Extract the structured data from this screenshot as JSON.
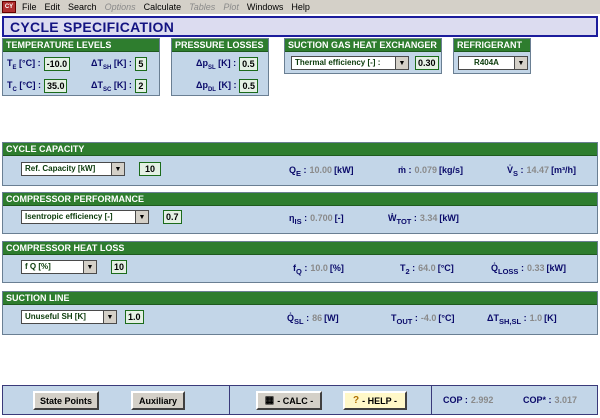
{
  "menu": {
    "items": [
      "File",
      "Edit",
      "Search",
      "Options",
      "Calculate",
      "Tables",
      "Plot",
      "Windows",
      "Help"
    ],
    "disabled": [
      "Options",
      "Tables",
      "Plot"
    ]
  },
  "title": "CYCLE SPECIFICATION",
  "temperature_levels": {
    "header": "TEMPERATURE LEVELS",
    "te_label": "T",
    "te_sub": "E",
    "te_unit": "[°C] :",
    "te_value": "-10.0",
    "tc_label": "T",
    "tc_sub": "C",
    "tc_unit": "[°C] :",
    "tc_value": "35.0",
    "dtsh_label": "ΔT",
    "dtsh_sub": "SH",
    "dtsh_unit": "[K] :",
    "dtsh_value": "5",
    "dtsc_label": "ΔT",
    "dtsc_sub": "SC",
    "dtsc_unit": "[K] :",
    "dtsc_value": "2"
  },
  "pressure_losses": {
    "header": "PRESSURE LOSSES",
    "psl_label": "Δp",
    "psl_sub": "SL",
    "psl_unit": "[K] :",
    "psl_value": "0.5",
    "pdl_label": "Δp",
    "pdl_sub": "DL",
    "pdl_unit": "[K] :",
    "pdl_value": "0.5"
  },
  "suction_hx": {
    "header": "SUCTION GAS HEAT EXCHANGER",
    "select": "Thermal efficiency [-] :",
    "value": "0.30"
  },
  "refrigerant": {
    "header": "REFRIGERANT",
    "select": "R404A"
  },
  "cycle_capacity": {
    "header": "CYCLE CAPACITY",
    "select": "Ref. Capacity [kW]",
    "value": "10",
    "qe_label": "Q",
    "qe_sub": "E",
    "qe_sep": " :",
    "qe_value": "10.00",
    "qe_unit": "[kW]",
    "m_label": "ṁ :",
    "m_value": "0.079",
    "m_unit": "[kg/s]",
    "vs_label": "V̇",
    "vs_sub": "S",
    "vs_sep": " :",
    "vs_value": "14.47",
    "vs_unit": "[m³/h]"
  },
  "compressor_performance": {
    "header": "COMPRESSOR PERFORMANCE",
    "select": "Isentropic efficiency [-]",
    "value": "0.7",
    "eta_label": "η",
    "eta_sub": "IS",
    "eta_sep": " :",
    "eta_value": "0.700",
    "eta_unit": "[-]",
    "w_label": "Ẇ",
    "w_sub": "TOT",
    "w_sep": " :",
    "w_value": "3.34",
    "w_unit": "[kW]"
  },
  "compressor_heat_loss": {
    "header": "COMPRESSOR HEAT LOSS",
    "select": "f Q [%]",
    "value": "10",
    "fq_label": "f",
    "fq_sub": "Q",
    "fq_sep": " :",
    "fq_value": "10.0",
    "fq_unit": "[%]",
    "t2_label": "T",
    "t2_sub": "2",
    "t2_sep": " :",
    "t2_value": "64.0",
    "t2_unit": "[°C]",
    "ql_label": "Q̇",
    "ql_sub": "LOSS",
    "ql_sep": " :",
    "ql_value": "0.33",
    "ql_unit": "[kW]"
  },
  "suction_line": {
    "header": "SUCTION LINE",
    "select": "Unuseful SH [K]",
    "value": "1.0",
    "qsl_label": "Q̇",
    "qsl_sub": "SL",
    "qsl_sep": " :",
    "qsl_value": "86",
    "qsl_unit": "[W]",
    "tout_label": "T",
    "tout_sub": "OUT",
    "tout_sep": " :",
    "tout_value": "-4.0",
    "tout_unit": "[°C]",
    "dtsh_label": "ΔT",
    "dtsh_sub": "SH,SL",
    "dtsh_sep": " :",
    "dtsh_value": "1.0",
    "dtsh_unit": "[K]"
  },
  "bottom": {
    "state_points": "State Points",
    "auxiliary": "Auxiliary",
    "calc": "- CALC -",
    "help": "- HELP -",
    "cop_label": "COP :",
    "cop_value": "2.992",
    "cop_star_label": "COP* :",
    "cop_star_value": "3.017"
  }
}
